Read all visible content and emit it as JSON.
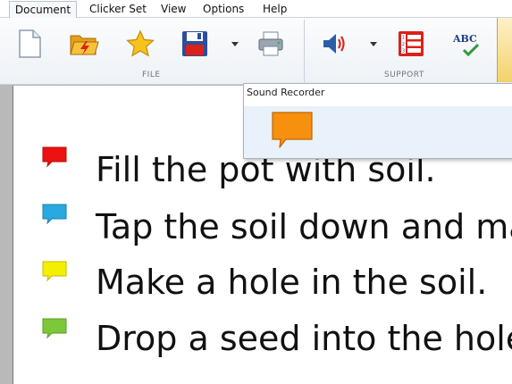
{
  "tabs": [
    "Document",
    "Clicker Set",
    "View",
    "Options",
    "Help"
  ],
  "ribbon": {
    "file_label": "FILE",
    "support_label": "SUPPORT",
    "buttons": [
      "new-document",
      "open-folder",
      "favorite-star",
      "save-floppy",
      "print",
      "speaker",
      "numbered-list",
      "spell-check"
    ],
    "abc_text": "ABC"
  },
  "popup": {
    "title": "Sound Recorder"
  },
  "document": {
    "lines": [
      {
        "text": "Fill the pot with soil.",
        "color": "#ee1111"
      },
      {
        "text": "Tap the soil down and ma",
        "color": "#29a9e0"
      },
      {
        "text": "Make a hole in the soil.",
        "color": "#f4ee00"
      },
      {
        "text": "Drop a seed into the hole",
        "color": "#7dc83a"
      }
    ]
  }
}
